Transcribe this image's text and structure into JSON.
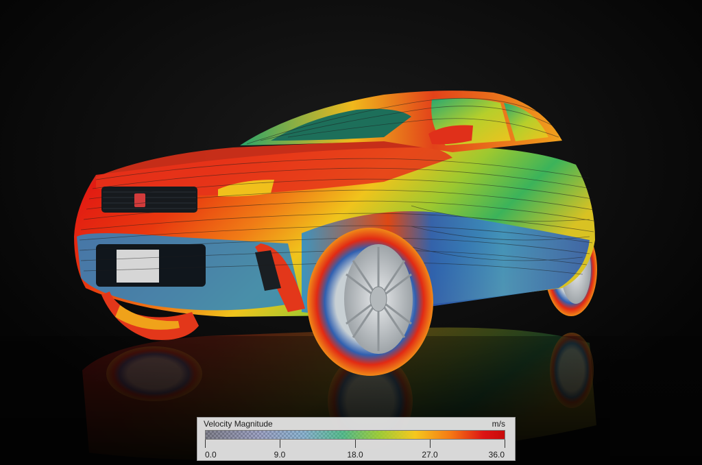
{
  "legend": {
    "title": "Velocity Magnitude",
    "unit": "m/s",
    "ticks": [
      "0.0",
      "9.0",
      "18.0",
      "27.0",
      "36.0"
    ],
    "range": [
      0.0,
      36.0
    ]
  },
  "scene": {
    "subject": "car",
    "background_color": "#070707",
    "colormap": [
      "#28283c",
      "#3c468c",
      "#3c82b4",
      "#28aa6e",
      "#96c828",
      "#f5c81e",
      "#f57814",
      "#dc1414"
    ]
  }
}
